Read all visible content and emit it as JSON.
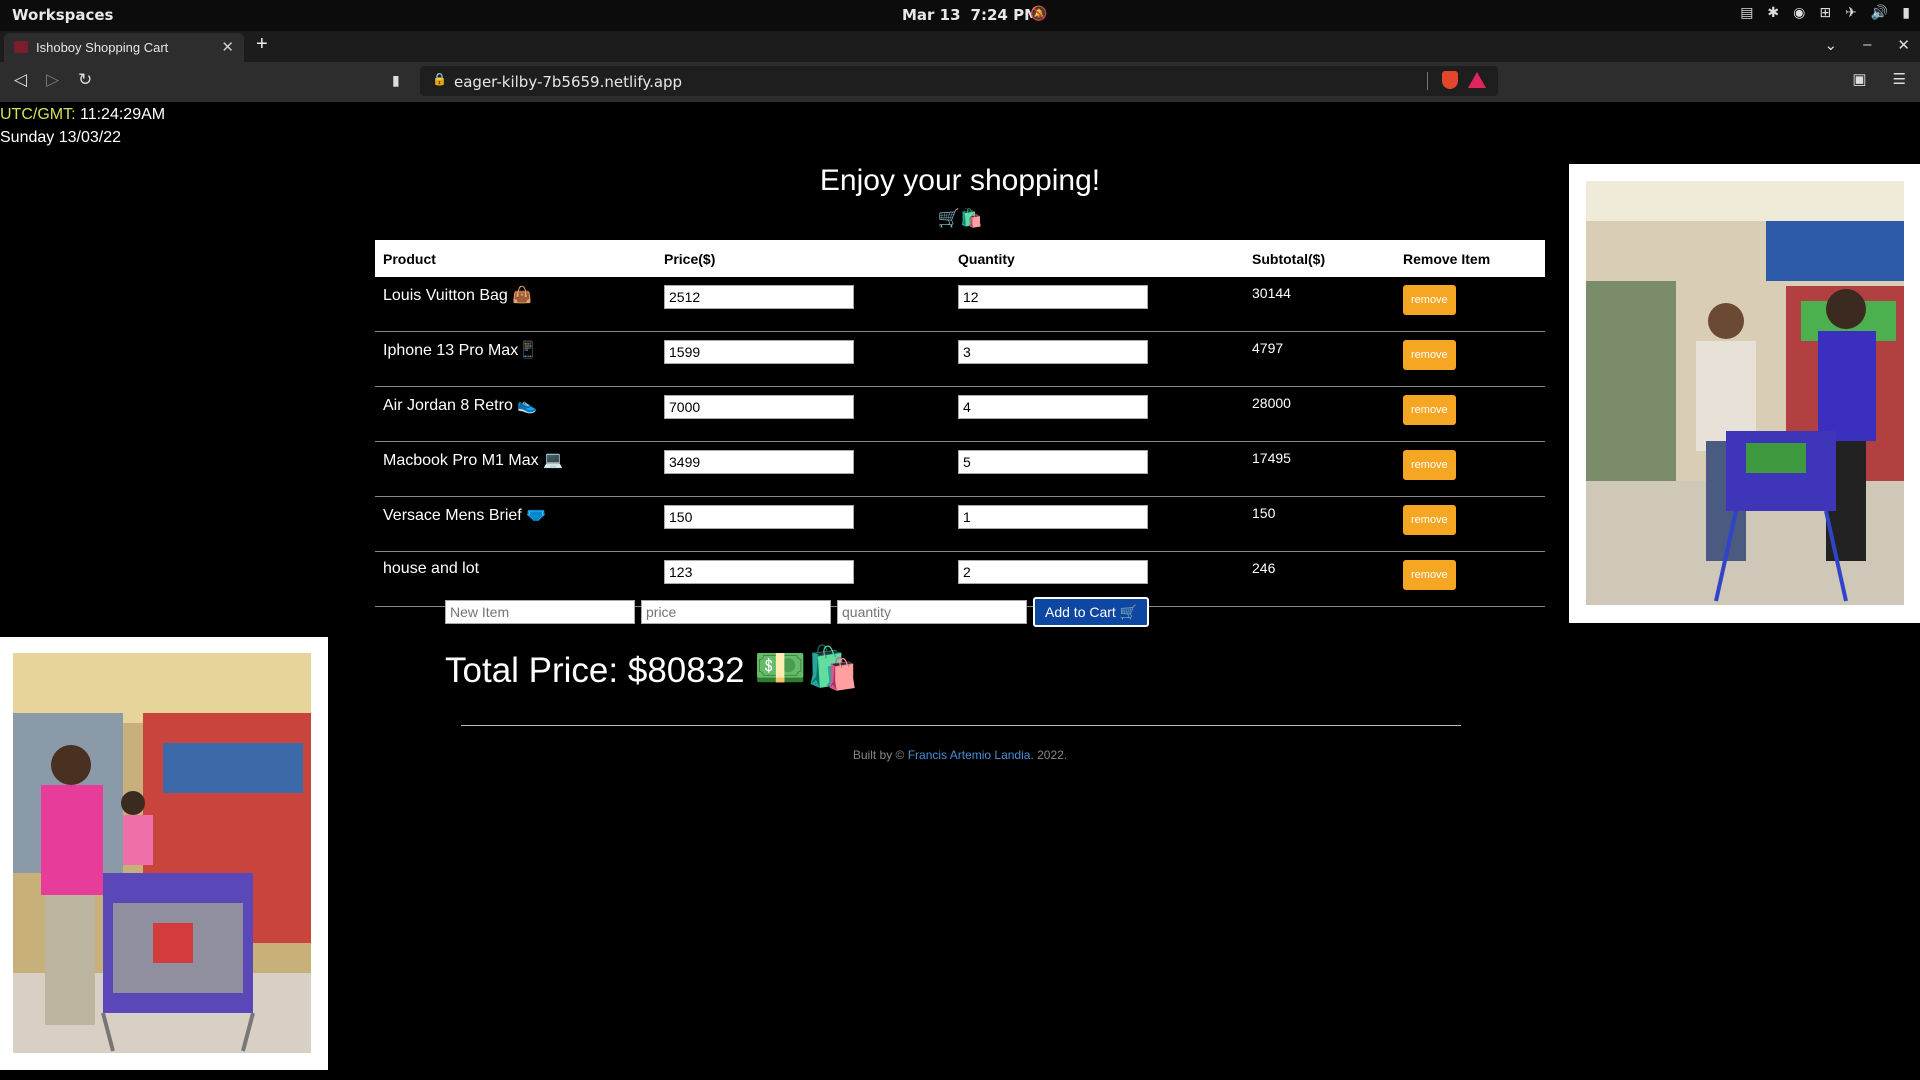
{
  "system_bar": {
    "workspaces": "Workspaces",
    "date": "Mar 13",
    "time": "7:24 PM"
  },
  "browser": {
    "tab_title": "Ishoboy Shopping Cart",
    "url": "eager-kilby-7b5659.netlify.app"
  },
  "clock": {
    "label": "UTC/GMT:",
    "time": "11:24:29AM",
    "date": "Sunday 13/03/22"
  },
  "heading": "Enjoy your shopping!",
  "heading_emojis": "🛒🛍️",
  "table": {
    "headers": [
      "Product",
      "Price($)",
      "Quantity",
      "Subtotal($)",
      "Remove Item"
    ],
    "rows": [
      {
        "product": "Louis Vuitton Bag 👜",
        "price": "2512",
        "quantity": "12",
        "subtotal": "30144",
        "remove": "remove"
      },
      {
        "product": "Iphone 13 Pro Max📱",
        "price": "1599",
        "quantity": "3",
        "subtotal": "4797",
        "remove": "remove"
      },
      {
        "product": "Air Jordan 8 Retro 👟",
        "price": "7000",
        "quantity": "4",
        "subtotal": "28000",
        "remove": "remove"
      },
      {
        "product": "Macbook Pro M1 Max 💻",
        "price": "3499",
        "quantity": "5",
        "subtotal": "17495",
        "remove": "remove"
      },
      {
        "product": "Versace Mens Brief 🩲",
        "price": "150",
        "quantity": "1",
        "subtotal": "150",
        "remove": "remove"
      },
      {
        "product": "house and lot",
        "price": "123",
        "quantity": "2",
        "subtotal": "246",
        "remove": "remove"
      }
    ]
  },
  "add_form": {
    "item_placeholder": "New Item",
    "price_placeholder": "price",
    "quantity_placeholder": "quantity",
    "button": "Add to Cart 🛒"
  },
  "total": {
    "label": "Total Price: $",
    "value": "80832",
    "emojis": "💵🛍️"
  },
  "footer": {
    "prefix": "Built by © ",
    "author": "Francis Artemio Landia",
    "suffix": ". 2022."
  },
  "colors": {
    "remove_button": "#f5a623",
    "add_button": "#0d47a1",
    "utc_label": "#d4e157",
    "footer_link": "#4a8fd8"
  }
}
